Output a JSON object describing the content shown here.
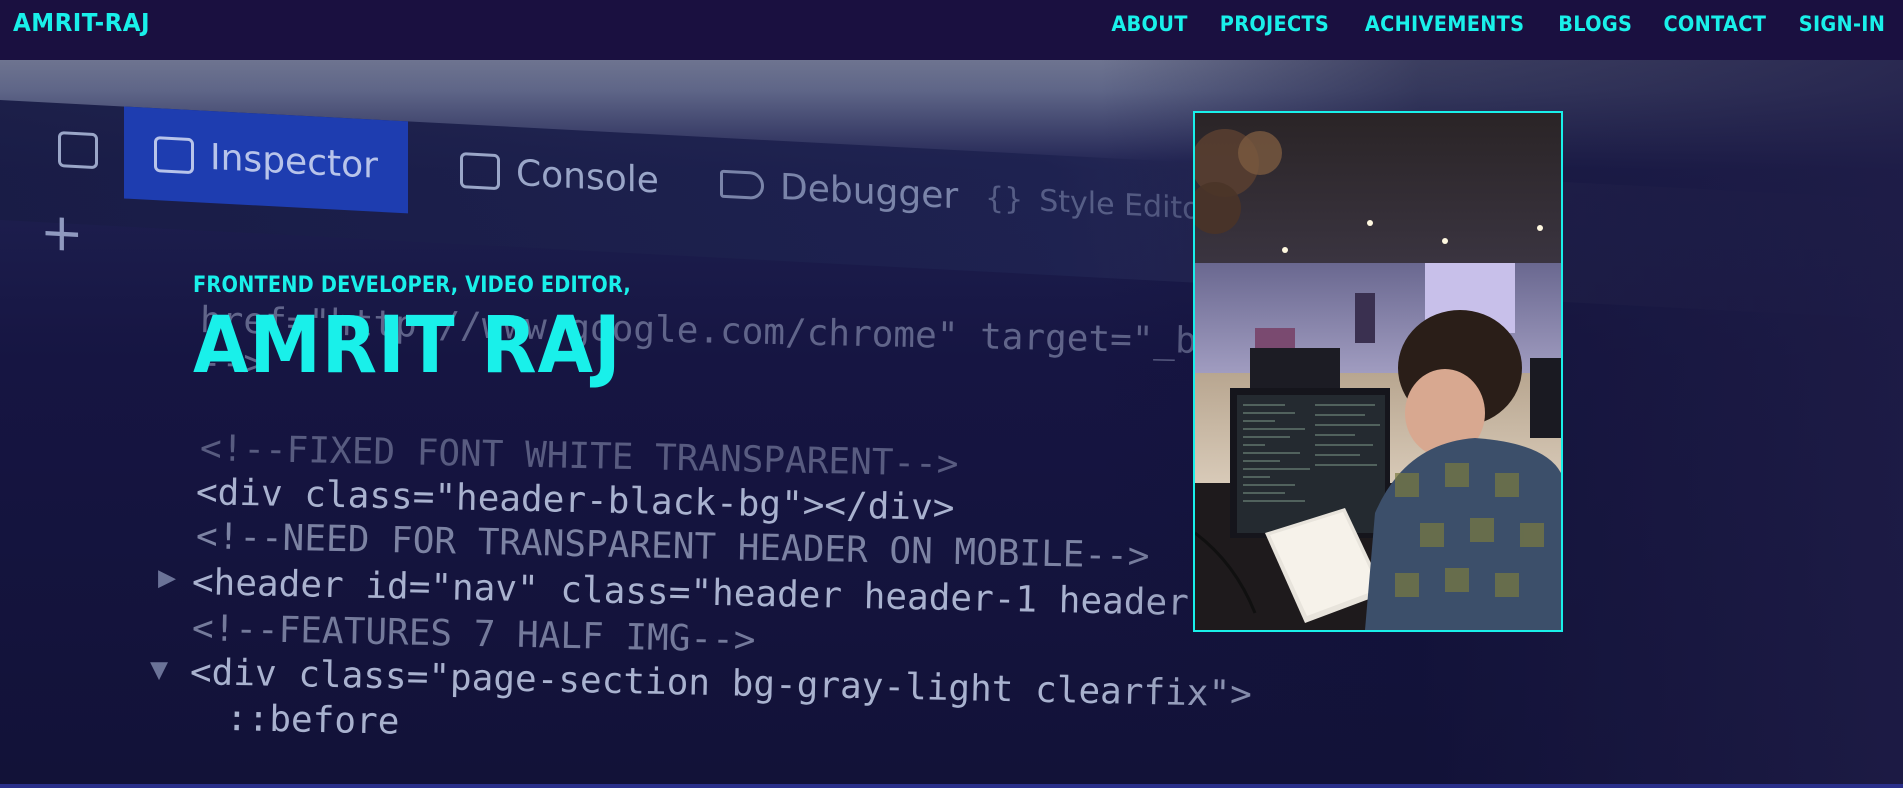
{
  "navbar": {
    "brand": "AMRIT-RAJ",
    "links": [
      "ABOUT",
      "PROJECTS",
      "ACHIVEMENTS",
      "BLOGS",
      "CONTACT",
      "SIGN-IN"
    ]
  },
  "hero": {
    "subtitle": "FRONTEND DEVELOPER, VIDEO EDITOR,",
    "name": "AMRIT RAJ",
    "background": {
      "devtools_tabs": [
        "Inspector",
        "Console",
        "Debugger",
        "Style Editor"
      ],
      "code_lines": [
        "href=\"http://www.google.com/chrome\" target=\"_blank\"",
        "-->",
        "<!--FIXED FONT WHITE TRANSPARENT-->",
        "<div class=\"header-black-bg\"></div>",
        "<!--NEED FOR TRANSPARENT HEADER ON MOBILE-->",
        "<header id=\"nav\" class=\"header header-1 header-b...",
        "<!--FEATURES 7 HALF IMG-->",
        "<div class=\"page-section bg-gray-light clearfix\">",
        "::before"
      ]
    },
    "photo": {
      "alt": "developer working at computer",
      "icon": "photo-image"
    }
  },
  "colors": {
    "accent": "#19f0ea",
    "navbar_bg": "#1a1040",
    "hero_bg": "#161542"
  }
}
